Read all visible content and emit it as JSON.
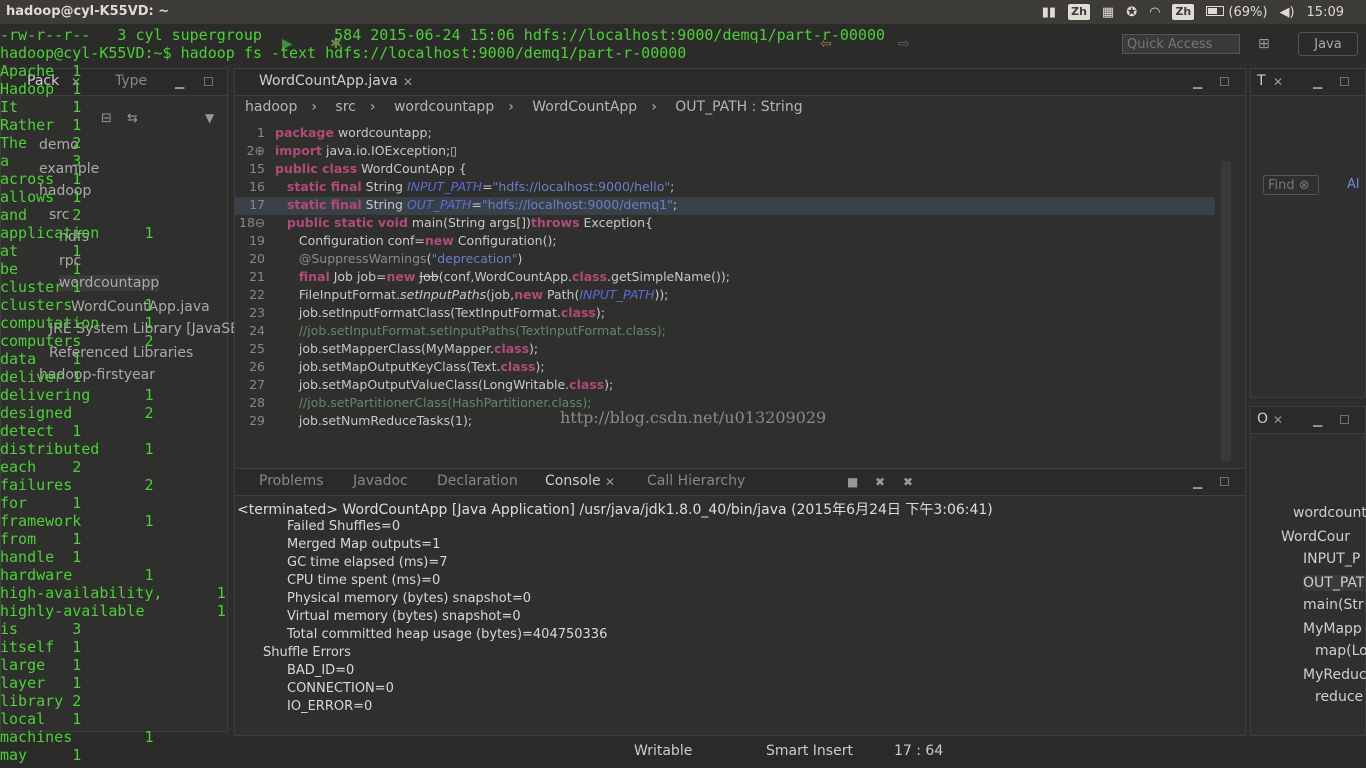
{
  "topbar": {
    "title": "hadoop@cyl-K55VD: ~",
    "ime1": "Zh",
    "ime2": "Zh",
    "battery": "(69%)",
    "time": "15:09"
  },
  "eclipse": {
    "quick_access": "Quick Access",
    "perspective": "Java",
    "left_tabs": [
      "Pack",
      "Type"
    ],
    "packages": [
      "demo",
      "example",
      "hadoop",
      "src",
      "hdfs",
      "rpc",
      "wordcountapp",
      "WordCountApp.java",
      "JRE System Library [JavaSE",
      "Referenced Libraries",
      "hadoop-firstyear"
    ],
    "editor_tab": "WordCountApp.java",
    "breadcrumbs": [
      "hadoop",
      "src",
      "wordcountapp",
      "WordCountApp",
      "OUT_PATH : String"
    ],
    "watermark": "http://blog.csdn.net/u013209029",
    "console_tabs": [
      "Problems",
      "Javadoc",
      "Declaration",
      "Console",
      "Call Hierarchy"
    ],
    "console_header": "<terminated> WordCountApp [Java Application] /usr/java/jdk1.8.0_40/bin/java (2015年6月24日 下午3:06:41)",
    "console_lines": [
      "Failed Shuffles=0",
      "Merged Map outputs=1",
      "GC time elapsed (ms)=7",
      "CPU time spent (ms)=0",
      "Physical memory (bytes) snapshot=0",
      "Virtual memory (bytes) snapshot=0",
      "Total committed heap usage (bytes)=404750336",
      "Shuffle Errors",
      "BAD_ID=0",
      "CONNECTION=0",
      "IO_ERROR=0"
    ],
    "right_top_tab": "T",
    "find_placeholder": "Find",
    "find_all": "Al",
    "outline_tab": "O",
    "outline_items": [
      "wordcount",
      "WordCour",
      "INPUT_P",
      "OUT_PAT",
      "main(Str",
      "MyMapp",
      "map(Lo",
      "MyReduc",
      "reduce"
    ],
    "status": {
      "writable": "Writable",
      "insert": "Smart Insert",
      "position": "17 : 64"
    }
  },
  "terminal": {
    "top_lines": [
      "-rw-r--r--   3 cyl supergroup        584 2015-06-24 15:06 hdfs://localhost:9000/demq1/part-r-00000",
      "hadoop@cyl-K55VD:~$ hadoop fs -text hdfs://localhost:9000/demq1/part-r-00000"
    ],
    "output": [
      "Apache  1",
      "Hadoop  1",
      "It      1",
      "Rather  1",
      "The     2",
      "a       3",
      "across  1",
      "allows  1",
      "and     2",
      "application     1",
      "at      1",
      "be      1",
      "cluster 1",
      "clusters        1",
      "computation     1",
      "computers       2",
      "data    1",
      "deliver 1",
      "delivering      1",
      "designed        2",
      "detect  1",
      "distributed     1",
      "each    2",
      "failures        2",
      "for     1",
      "framework       1",
      "from    1",
      "handle  1",
      "hardware        1",
      "high-availability,      1",
      "highly-available        1",
      "is      3",
      "itself  1",
      "large   1",
      "layer   1",
      "library 2",
      "local   1",
      "machines        1",
      "may     1"
    ]
  }
}
